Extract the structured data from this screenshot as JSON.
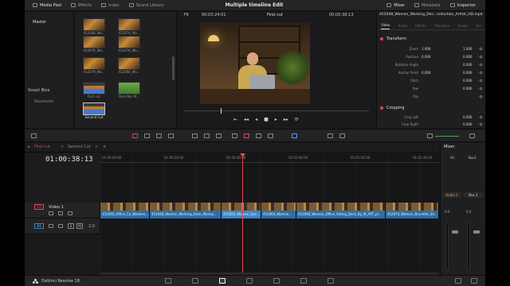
{
  "window": {
    "title": "Multiple timeline Edit"
  },
  "topbar": {
    "left_tabs": [
      {
        "label": "Media Pool",
        "icon": "media-pool-icon",
        "active": true
      },
      {
        "label": "Effects",
        "icon": "effects-icon",
        "active": false
      },
      {
        "label": "Index",
        "icon": "index-icon",
        "active": false
      },
      {
        "label": "Sound Library",
        "icon": "sound-library-icon",
        "active": false
      }
    ],
    "right_tabs": [
      {
        "label": "Mixer",
        "icon": "mixer-icon",
        "active": true
      },
      {
        "label": "Metadata",
        "icon": "metadata-icon",
        "active": false
      },
      {
        "label": "Inspector",
        "icon": "inspector-icon",
        "active": true
      }
    ]
  },
  "bins": {
    "master": "Master",
    "smart_bins": "Smart Bins",
    "keywords": "Keywords"
  },
  "media_pool": {
    "clips": [
      {
        "label": "452066_Wo...",
        "style": "footage"
      },
      {
        "label": "452074_Wo...",
        "style": "footage"
      },
      {
        "label": "452076_Wo...",
        "style": "footage"
      },
      {
        "label": "452078_Wo...",
        "style": "footage"
      },
      {
        "label": "452079_Wo...",
        "style": "footage"
      },
      {
        "label": "452084_Wo...",
        "style": "footage"
      },
      {
        "label": "First cut",
        "style": "timeline"
      },
      {
        "label": "Rom Bar M...",
        "style": "green"
      },
      {
        "label": "Second Cut",
        "style": "timeline",
        "selected": true
      }
    ]
  },
  "viewer": {
    "fit": "Fit",
    "source_timecode": "00:03:24:01",
    "timeline_name": "First cut",
    "record_timecode": "00:00:38:13",
    "transport": [
      "⇤",
      "◂◂",
      "◂",
      "■",
      "▸",
      "▸▸",
      "⟳"
    ]
  },
  "inspector": {
    "clip_name": "452048_Woman_Working_Des...roduction_Artlist_HD.mp4",
    "tabs": [
      {
        "label": "Video",
        "active": true
      },
      {
        "label": "Audio",
        "active": false
      },
      {
        "label": "Effects",
        "active": false
      },
      {
        "label": "Transition",
        "active": false
      },
      {
        "label": "Image",
        "active": false
      },
      {
        "label": "File",
        "active": false
      }
    ],
    "transform_label": "Transform",
    "properties": [
      {
        "label": "Zoom",
        "x": "1.000",
        "y": "1.000"
      },
      {
        "label": "Position",
        "x": "0.000",
        "y": "0.000"
      },
      {
        "label": "Rotation Angle",
        "x": "",
        "y": "0.000"
      },
      {
        "label": "Anchor Point",
        "x": "0.000",
        "y": "0.000"
      },
      {
        "label": "Pitch",
        "x": "",
        "y": "0.000"
      },
      {
        "label": "Yaw",
        "x": "",
        "y": "0.000"
      },
      {
        "label": "Flip",
        "x": "",
        "y": ""
      }
    ],
    "cropping_label": "Cropping",
    "crop_props": [
      {
        "label": "Crop Left",
        "x": "",
        "y": "0.000"
      },
      {
        "label": "Crop Right",
        "x": "",
        "y": "0.000"
      }
    ]
  },
  "timeline": {
    "tabs": [
      {
        "label": "First cut",
        "active": true
      },
      {
        "label": "Second Cut",
        "active": false
      }
    ],
    "timecode": "01:00:38:13",
    "ruler": [
      "01:00:00:00",
      "01:00:20:00",
      "01:00:40:00",
      "01:01:00:00",
      "01:01:20:00",
      "01:01:40:00"
    ],
    "video_track": {
      "id": "V1",
      "name": "Video 1"
    },
    "audio_track": {
      "id": "A1",
      "level": "2.0"
    },
    "clips": [
      {
        "name": "452046_Office_Co_Workers..."
      },
      {
        "name": "452048_Woman_Working_Desk_Money..."
      },
      {
        "name": "452050_Woman_Eye..."
      },
      {
        "name": "452064_Woman..."
      },
      {
        "name": "452066_Woman_Office_Sitting_Desk_By_M_ART_pr..."
      },
      {
        "name": "452074_Woman_Brunette_Sh..."
      }
    ]
  },
  "mixer": {
    "title": "Mixer",
    "channels": [
      {
        "name": "A1",
        "strip": "Audio 1",
        "value": "0.0"
      },
      {
        "name": "Bus1",
        "strip": "Bus 1",
        "value": "0.0"
      }
    ]
  },
  "bottombar": {
    "app": "DaVinci Resolve 18",
    "pages": [
      "media-page",
      "cut-page",
      "edit-page",
      "fusion-page",
      "color-page",
      "fairlight-page",
      "deliver-page"
    ],
    "active_page": "edit-page"
  },
  "colors": {
    "accent": "#e5484d",
    "clip_blue": "#2d6ea8",
    "panel": "#1f1f21"
  }
}
